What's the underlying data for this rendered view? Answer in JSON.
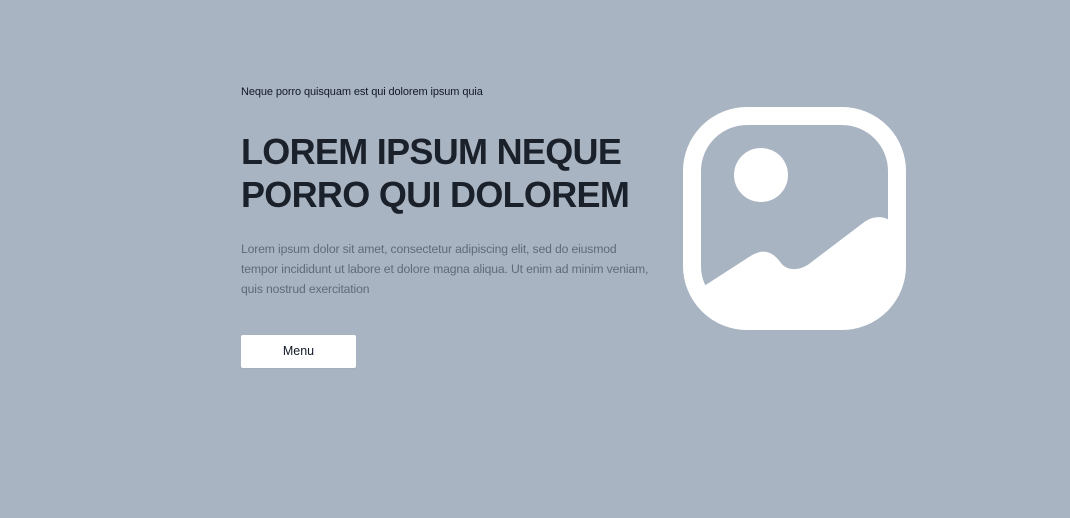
{
  "hero": {
    "eyebrow": "Neque porro quisquam est qui dolorem ipsum quia",
    "title_line_1": "LOREM IPSUM NEQUE",
    "title_line_2": "PORRO QUI DOLOREM",
    "description": "Lorem ipsum dolor sit amet, consectetur adipiscing elit, sed do eiusmod tempor incididunt ut labore et dolore magna aliqua. Ut enim ad minim veniam, quis nostrud exercitation",
    "menu_button": "Menu"
  },
  "colors": {
    "background": "#a9b4c2",
    "heading": "#1b212b",
    "body_text": "#5f6b7a",
    "button_background": "#ffffff",
    "image_icon": "#ffffff"
  },
  "icons": {
    "hero_image": "image-placeholder-icon"
  }
}
